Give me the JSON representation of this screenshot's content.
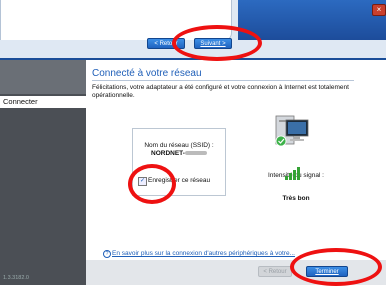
{
  "back_window": {
    "back_button": "< Retour",
    "next_button": "Suivant >"
  },
  "close_button": "×",
  "sidebar": {
    "active_item": "Connecter",
    "version": "1.3.3182.0"
  },
  "content": {
    "title": "Connecté à votre réseau",
    "description": "Félicitations, votre adaptateur a été configuré et votre connexion à Internet est totalement opérationnelle.",
    "ssid_label": "Nom du réseau (SSID) :",
    "ssid_value": "NORDNET-",
    "save_network_label": "Enregistrer ce réseau",
    "save_network_checked": true,
    "signal_label": "Intensité du signal :",
    "signal_value": "Très bon",
    "signal_bars": 4,
    "help_link": "En savoir plus sur la connexion d'autres périphériques à votre..."
  },
  "footer": {
    "disabled_button": "< Retour",
    "finish_button": "Terminer"
  }
}
